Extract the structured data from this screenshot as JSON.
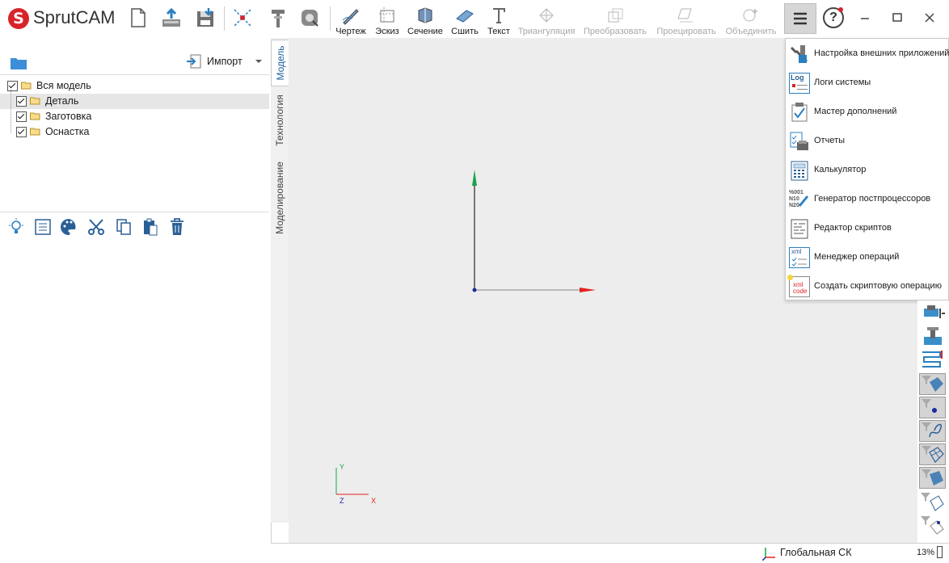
{
  "app": {
    "logo_text": "SprutCAM",
    "logo_letter": "S"
  },
  "toolbar": {
    "buttons": [
      {
        "label": "Чертеж",
        "disabled": false
      },
      {
        "label": "Эскиз",
        "disabled": false
      },
      {
        "label": "Сечение",
        "disabled": false
      },
      {
        "label": "Сшить",
        "disabled": false
      },
      {
        "label": "Текст",
        "disabled": false
      },
      {
        "label": "Триангуляция",
        "disabled": true
      },
      {
        "label": "Преобразовать",
        "disabled": true
      },
      {
        "label": "Проецировать",
        "disabled": true
      },
      {
        "label": "Объединить",
        "disabled": true
      }
    ],
    "help_glyph": "?"
  },
  "left_panel": {
    "import_label": "Импорт",
    "tree": [
      {
        "label": "Вся модель",
        "checked": true,
        "selected": false,
        "level": 0
      },
      {
        "label": "Деталь",
        "checked": true,
        "selected": true,
        "level": 1
      },
      {
        "label": "Заготовка",
        "checked": true,
        "selected": false,
        "level": 1
      },
      {
        "label": "Оснастка",
        "checked": true,
        "selected": false,
        "level": 1
      }
    ]
  },
  "tabs": {
    "model": "Модель",
    "technology": "Технология",
    "modeling": "Моделирование"
  },
  "menu": {
    "items": [
      {
        "label": "Настройка внешних приложений",
        "icon": "tools-icon"
      },
      {
        "label": "Логи системы",
        "icon": "log-icon",
        "icon_text": "Log"
      },
      {
        "label": "Мастер дополнений",
        "icon": "addon-wizard-icon"
      },
      {
        "label": "Отчеты",
        "icon": "reports-icon"
      },
      {
        "label": "Калькулятор",
        "icon": "calculator-icon"
      },
      {
        "label": "Генератор постпроцессоров",
        "icon": "postprocessor-icon",
        "icon_text": "%001 N10 N20"
      },
      {
        "label": "Редактор скриптов",
        "icon": "script-editor-icon"
      },
      {
        "label": "Менеджер операций",
        "icon": "operation-manager-icon",
        "icon_text": "xml"
      },
      {
        "label": "Создать скриптовую операцию",
        "icon": "create-script-operation-icon",
        "icon_text": "xml code"
      }
    ]
  },
  "axes_triad": {
    "y": "Y",
    "z": "Z",
    "x": "X"
  },
  "statusbar": {
    "coord_system": "Глобальная СК",
    "zoom": "13%"
  },
  "colors": {
    "accent": "#1a5c9e",
    "brand": "#d9232a",
    "axis_x": "#e52020",
    "axis_y": "#1aa34a",
    "viewport_bg": "#ededed"
  }
}
